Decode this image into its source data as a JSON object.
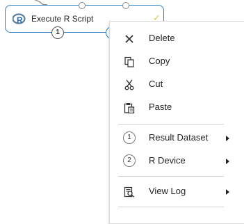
{
  "module": {
    "title": "Execute R Script",
    "icon": "r-logo-icon",
    "output_port_number": "1",
    "accent_color": "#2d7fc4"
  },
  "context_menu": {
    "items": [
      {
        "label": "Delete",
        "icon": "delete-x-icon"
      },
      {
        "label": "Copy",
        "icon": "copy-icon"
      },
      {
        "label": "Cut",
        "icon": "scissors-icon"
      },
      {
        "label": "Paste",
        "icon": "paste-icon"
      },
      {
        "label": "Result Dataset",
        "icon": "number-circle-icon",
        "number": "1",
        "has_submenu": true
      },
      {
        "label": "R Device",
        "icon": "number-circle-icon",
        "number": "2",
        "has_submenu": true
      },
      {
        "label": "View Log",
        "icon": "view-log-icon",
        "has_submenu": true
      }
    ]
  }
}
